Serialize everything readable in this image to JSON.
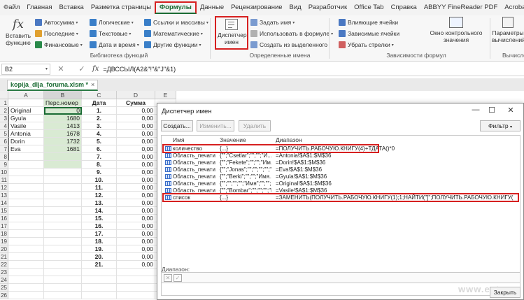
{
  "tabs": [
    "Файл",
    "Главная",
    "Вставка",
    "Разметка страницы",
    "Формулы",
    "Данные",
    "Рецензирование",
    "Вид",
    "Разработчик",
    "Office Tab",
    "Справка",
    "ABBYY FineReader PDF",
    "Acrobat"
  ],
  "ribbon": {
    "insert_function": "Вставить функцию",
    "lib_col1": [
      "Автосумма",
      "Последние",
      "Финансовые"
    ],
    "lib_col2": [
      "Логические",
      "Текстовые",
      "Дата и время"
    ],
    "lib_col3": [
      "Ссылки и массивы",
      "Математические",
      "Другие функции"
    ],
    "lib_label": "Библиотека функций",
    "name_manager": "Диспетчер имен",
    "names_col": [
      "Задать имя",
      "Использовать в формуле",
      "Создать из выделенного"
    ],
    "names_label": "Определенные имена",
    "deps_col1": [
      "Влияющие ячейки",
      "Зависимые ячейки",
      "Убрать стрелки"
    ],
    "watch": "Окно контрольного значения",
    "deps_label": "Зависимости формул",
    "calc_params": "Параметры вычислений",
    "calc_label": "Вычисле"
  },
  "formula_bar": {
    "name_box": "B2",
    "fx": "fx",
    "formula": "=ДВССЫЛ(A2&\"!\"&\"J\"&1)",
    "cancel": "✕",
    "enter": "✓"
  },
  "file_tab": {
    "name": "kopija_dlja_foruma.xlsm *",
    "close": "×"
  },
  "columns": [
    "A",
    "B",
    "C",
    "D",
    "E"
  ],
  "headers": {
    "b": "Перс.номер",
    "c": "Дата",
    "d": "Сумма"
  },
  "rows_a": [
    "Original",
    "Gyula",
    "Vasile",
    "Antonia",
    "Dorin",
    "Eva"
  ],
  "rows_b": [
    "0",
    "1680",
    "1413",
    "1678",
    "1732",
    "1681"
  ],
  "rows_c": [
    "1.",
    "2.",
    "3.",
    "4.",
    "5.",
    "6.",
    "7.",
    "8.",
    "9.",
    "10.",
    "11.",
    "12.",
    "13.",
    "14.",
    "15.",
    "16.",
    "17.",
    "18.",
    "19.",
    "20.",
    "21."
  ],
  "sum_val": "0,00",
  "dialog": {
    "title": "Диспетчер имен",
    "create": "Создать...",
    "edit": "Изменить...",
    "delete": "Удалить",
    "filter": "Фильтр",
    "col_name": "Имя",
    "col_value": "Значение",
    "col_range": "Диапазон",
    "rows": [
      {
        "name": "количество",
        "value": "{...}",
        "range": "=ПОЛУЧИТЬ.РАБОЧУЮ.КНИГУ(4)+ТДАТА()*0"
      },
      {
        "name": "Область_печати",
        "value": "{\"\";\"Csetlar\";\"\";\"\";\"И...",
        "range": "=Antonia!$A$1:$M$36"
      },
      {
        "name": "Область_печати",
        "value": "{\"\";\"Fekete\";\"\";\"\";\"Им...",
        "range": "=Dorin!$A$1:$M$36"
      },
      {
        "name": "Область_печати",
        "value": "{\"\";\"Jonas\";\"\";\"\";\"\";\"\";\"...",
        "range": "=Eva!$A$1:$M$36"
      },
      {
        "name": "Область_печати",
        "value": "{\"\";\"Berki\";\"\";\"\";\"Имя...",
        "range": "=Gyula!$A$1:$M$36"
      },
      {
        "name": "Область_печати",
        "value": "{\"\";\"\";\"\";\"\";\"Имя\";\"\";\"\";...",
        "range": "=Original!$A$1:$M$36"
      },
      {
        "name": "Область_печати",
        "value": "{\"\";\"Bombar\";\"\";\"\";\"\";\"И...",
        "range": "=Vasile!$A$1:$M$36"
      },
      {
        "name": "список",
        "value": "{...}",
        "range": "=ЗАМЕНИТЬ(ПОЛУЧИТЬ.РАБОЧУЮ.КНИГУ(1);1;НАЙТИ(\"]\";ПОЛУЧИТЬ.РАБОЧУЮ.КНИГУ(1));\"\")&Т(ТДАТА())"
      }
    ],
    "range_label": "Диапазон:",
    "close": "Закрыть"
  },
  "watermark": "www.extra"
}
